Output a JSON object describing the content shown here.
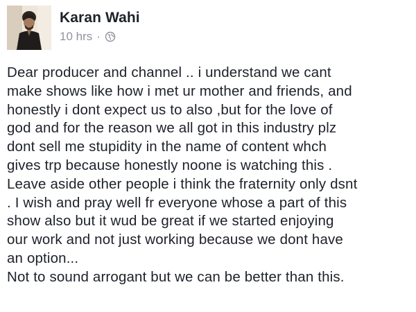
{
  "post": {
    "author": "Karan Wahi",
    "timestamp": "10 hrs",
    "separator": "·",
    "privacy_icon": "globe-icon",
    "text_lines": [
      "Dear producer and channel .. i understand we cant",
      "make shows like how i met ur mother and friends, and",
      "honestly i dont expect us to also ,but for the love of",
      "god and for the reason we all got in this industry plz",
      "dont sell me stupidity in the name of content whch",
      "gives trp because honestly noone is watching this .",
      "Leave aside other people i think the fraternity only dsnt",
      ". I wish and pray well fr everyone whose a part of this",
      "show also but it wud be great if we started enjoying",
      "our work and not just working because we dont have",
      "an option...",
      "Not to sound arrogant but we can be better than this."
    ]
  }
}
